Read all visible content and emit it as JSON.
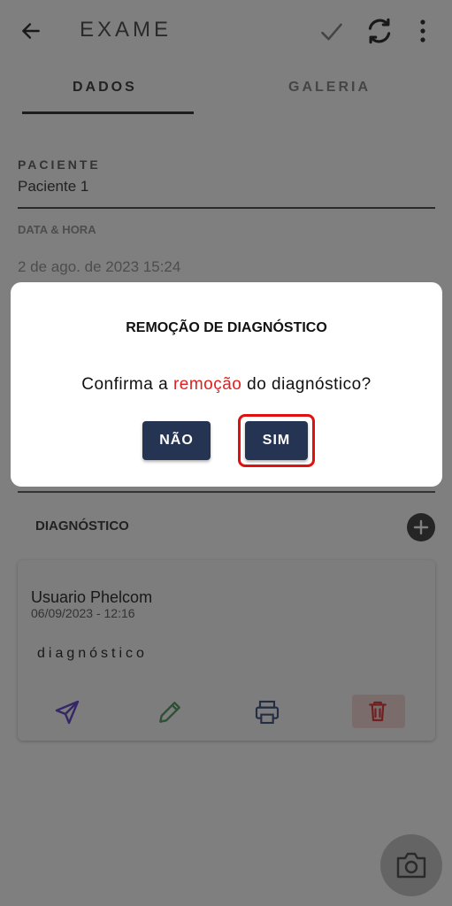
{
  "appbar": {
    "title": "EXAME",
    "icons": [
      "arrow-left-icon",
      "check-icon",
      "sync-icon",
      "more-vertical-icon"
    ]
  },
  "tabs": [
    {
      "label": "DADOS",
      "active": true
    },
    {
      "label": "GALERIA",
      "active": false
    }
  ],
  "form": {
    "paciente_label": "PACIENTE",
    "paciente_value": "Paciente 1",
    "datahora_label": "DATA & HORA",
    "datahora_value": "2 de ago. de 2023 15:24"
  },
  "diagnostico": {
    "section_title": "DIAGNÓSTICO",
    "card": {
      "user": "Usuario Phelcom",
      "date": "06/09/2023 - 12:16",
      "text": "diagnóstico",
      "actions": [
        "send-icon",
        "edit-icon",
        "print-icon",
        "trash-icon"
      ]
    }
  },
  "dialog": {
    "title": "REMOÇÃO DE DIAGNÓSTICO",
    "message_before": "Confirma a ",
    "message_highlight": "remoção",
    "message_after": " do diagnóstico?",
    "no_label": "NÃO",
    "yes_label": "SIM"
  },
  "colors": {
    "button_bg": "#263454",
    "highlight_red": "#e02020",
    "scrim": "rgba(0,0,0,0.5)"
  }
}
